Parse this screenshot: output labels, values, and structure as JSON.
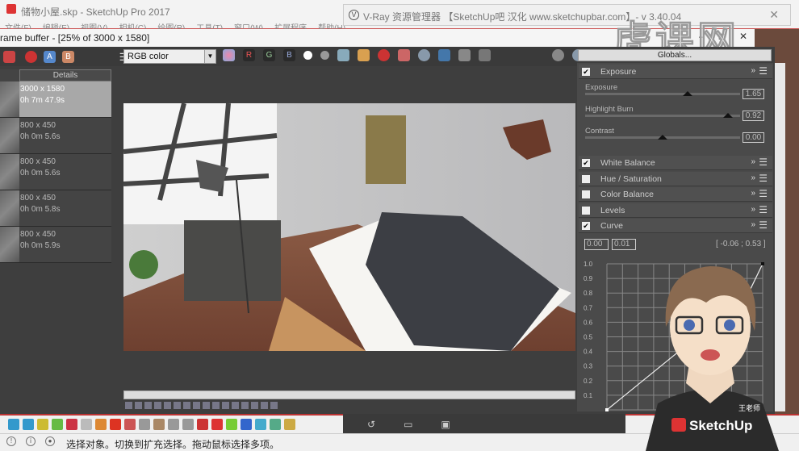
{
  "sketchup": {
    "title": "储物小屋.skp - SketchUp Pro 2017",
    "menu": [
      "文件(F)",
      "编辑(E)",
      "视图(V)",
      "相机(C)",
      "绘图(R)",
      "工具(T)",
      "窗口(W)",
      "扩展程序",
      "帮助(H)"
    ],
    "status": "选择对象。切换到扩充选择。拖动鼠标选择多项。"
  },
  "vray_manager": {
    "title": "V-Ray 资源管理器 【SketchUp吧 汉化 www.sketchupbar.com】- v 3.40.04",
    "close": "✕"
  },
  "watermark": "虎课网",
  "vfb": {
    "title": "rame buffer - [25% of 3000 x 1580]",
    "window_controls": [
      "–",
      "□",
      "✕"
    ],
    "channel_select": "RGB color",
    "channel_buttons": [
      "R",
      "G",
      "B"
    ],
    "globals_button": "Globals...",
    "history": {
      "header": "Details",
      "items": [
        {
          "size": "3000 x 1580",
          "time": "0h 7m 47.9s",
          "selected": true
        },
        {
          "size": "800 x 450",
          "time": "0h 0m 5.6s"
        },
        {
          "size": "800 x 450",
          "time": "0h 0m 5.6s"
        },
        {
          "size": "800 x 450",
          "time": "0h 0m 5.8s"
        },
        {
          "size": "800 x 450",
          "time": "0h 0m 5.9s"
        }
      ]
    },
    "corrections": {
      "exposure": {
        "label": "Exposure",
        "enabled": true,
        "sliders": [
          {
            "label": "Exposure",
            "value": "1.65",
            "pos": 0.66
          },
          {
            "label": "Highlight Burn",
            "value": "0.92",
            "pos": 0.92
          },
          {
            "label": "Contrast",
            "value": "0.00",
            "pos": 0.5
          }
        ]
      },
      "layers": [
        {
          "label": "White Balance",
          "enabled": true
        },
        {
          "label": "Hue / Saturation",
          "enabled": false
        },
        {
          "label": "Color Balance",
          "enabled": false
        },
        {
          "label": "Levels",
          "enabled": false
        },
        {
          "label": "Curve",
          "enabled": true
        }
      ],
      "curve": {
        "input_a": "0.00",
        "input_b": "0.01",
        "coord": "[ -0.06 ; 0.53 ]",
        "y_ticks": [
          "1.0",
          "0.9",
          "0.8",
          "0.7",
          "0.6",
          "0.5",
          "0.4",
          "0.3",
          "0.2",
          "0.1"
        ]
      }
    }
  },
  "presenter": {
    "name_tag": "王老师",
    "shirt_logo": "SketchUp"
  }
}
